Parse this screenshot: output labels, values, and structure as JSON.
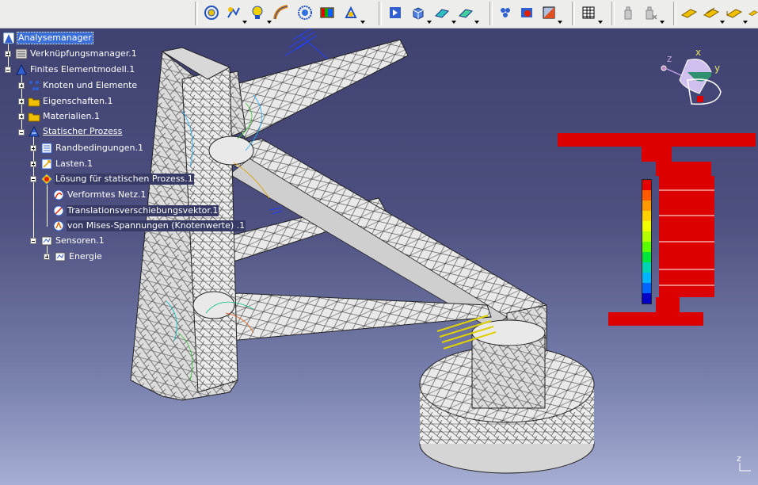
{
  "toolbar": {
    "groups": [
      {
        "icons": [
          "sensor-reaction-icon",
          "smooth-connection-icon",
          "bulb-icon",
          "measure-icon",
          "target-icon",
          "display-image-icon",
          "stars-icon"
        ]
      },
      {
        "icons": [
          "compute-icon",
          "cube-icon",
          "iso-surface-icon",
          "iso-section-icon"
        ]
      },
      {
        "icons": [
          "restraint-icon",
          "deform-icon",
          "color-palette-icon"
        ]
      },
      {
        "icons": [
          "grid-icon"
        ]
      },
      {
        "icons": [
          "bottle-icon",
          "bottle-x-icon"
        ]
      },
      {
        "icons": [
          "plane-icon",
          "plane-cut-icon",
          "plane-left-icon",
          "plane-right-icon"
        ]
      }
    ]
  },
  "tree": {
    "root": "Analysemanager",
    "link_manager": "Verknüpfungsmanager.1",
    "fem_model": "Finites Elementmodell.1",
    "nodes_elements": "Knoten und Elemente",
    "properties": "Eigenschaften.1",
    "materials": "Materialien.1",
    "static_case": "Statischer Prozess",
    "boundary_conditions": "Randbedingungen.1",
    "loads": "Lasten.1",
    "solution": "Lösung für statischen Prozess.1",
    "deformed_mesh": "Verformtes Netz.1",
    "translation_vector": "Translationsverschiebungsvektor.1",
    "von_mises": "von Mises-Spannungen (Knotenwerte) .1",
    "sensors": "Sensoren.1",
    "energy": "Energie"
  },
  "compass": {
    "axis_z": "z",
    "axis_x": "x",
    "axis_y": "y"
  },
  "axis_corner": {
    "axis_z": "z"
  },
  "colors": {
    "background_top": "#3d3f6e",
    "background_bottom": "#a6aed3",
    "selection": "#3a6ed6",
    "palette_red": "#dd0000",
    "mesh_face": "#e9e9e9"
  },
  "legend": {
    "colors": [
      "#e60000",
      "#ff5a00",
      "#ff9900",
      "#ffd200",
      "#f0ff00",
      "#b4ff00",
      "#5aff00",
      "#00e63c",
      "#00d2b4",
      "#00b4ff",
      "#0064ff",
      "#0000c8"
    ]
  }
}
